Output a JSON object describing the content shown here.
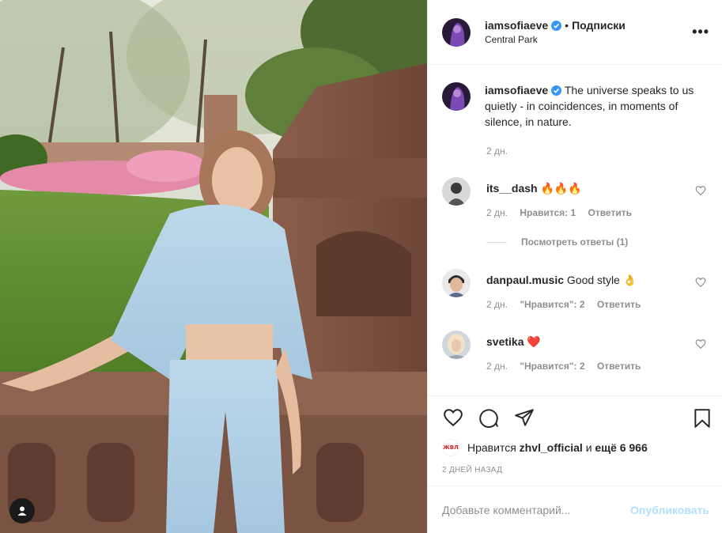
{
  "post": {
    "username": "iamsofiaeve",
    "follow_label": "Подписки",
    "dot": "•",
    "location": "Central Park",
    "caption": "The universe speaks to us quietly - in coincidences, in moments of silence, in nature.",
    "caption_time": "2 дн."
  },
  "comments": [
    {
      "username": "its__dash",
      "text": "🔥🔥🔥",
      "time": "2 дн.",
      "likes": "Нравится: 1",
      "reply": "Ответить"
    },
    {
      "username": "danpaul.music",
      "text": "Good style 👌",
      "time": "2 дн.",
      "likes": "\"Нравится\": 2",
      "reply": "Ответить"
    },
    {
      "username": "svetika",
      "text": "❤️",
      "time": "2 дн.",
      "likes": "\"Нравится\": 2",
      "reply": "Ответить"
    }
  ],
  "view_replies": "Посмотреть ответы (1)",
  "likes": {
    "prefix": "Нравится",
    "user": "zhvl_official",
    "connector": "и",
    "others": "ещё 6 966",
    "avatar_text": "ЖВЛ"
  },
  "posted_ago": "2 ДНЕЙ НАЗАД",
  "add_comment": {
    "placeholder": "Добавьте комментарий...",
    "publish_label": "Опубликовать"
  },
  "colors": {
    "verified": "#3897f0",
    "publish_disabled": "#b2dffc",
    "muted": "#8e8e8e",
    "text": "#262626"
  },
  "icons": [
    "heart-icon",
    "comment-icon",
    "share-icon",
    "bookmark-icon",
    "more-icon",
    "verified-icon",
    "user-tag-icon"
  ]
}
